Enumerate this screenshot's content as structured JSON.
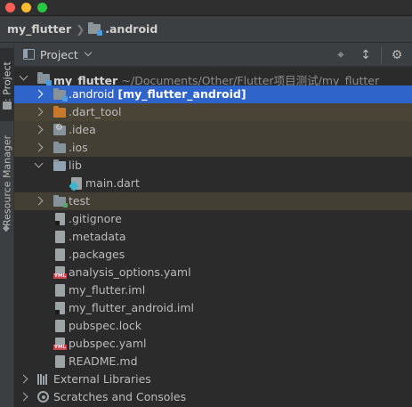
{
  "breadcrumb": {
    "project": "my_flutter",
    "folder": ".android"
  },
  "left_tabs": {
    "project": "1: Project",
    "resource_manager": "Resource Manager"
  },
  "tool_window": {
    "view_label": "Project"
  },
  "tree": {
    "root_name": "my_flutter",
    "root_path": "~/Documents/Other/Flutter项目测试/my_flutter",
    "items": [
      {
        "label": ".android",
        "module": "[my_flutter_android]"
      },
      {
        "label": ".dart_tool"
      },
      {
        "label": ".idea"
      },
      {
        "label": ".ios"
      },
      {
        "label": "lib"
      },
      {
        "label": "main.dart"
      },
      {
        "label": "test"
      },
      {
        "label": ".gitignore"
      },
      {
        "label": ".metadata"
      },
      {
        "label": ".packages"
      },
      {
        "label": "analysis_options.yaml"
      },
      {
        "label": "my_flutter.iml"
      },
      {
        "label": "my_flutter_android.iml"
      },
      {
        "label": "pubspec.lock"
      },
      {
        "label": "pubspec.yaml"
      },
      {
        "label": "README.md"
      },
      {
        "label": "External Libraries"
      },
      {
        "label": "Scratches and Consoles"
      }
    ]
  },
  "colors": {
    "selection": "#2f65ca",
    "close": "#ff5f57",
    "minimize": "#febc2e",
    "maximize": "#28c840",
    "excluded_folder": "#c9792b"
  },
  "icons": {
    "locate": "crosshair-icon",
    "collapse": "collapse-all-icon",
    "settings": "gear-icon"
  }
}
